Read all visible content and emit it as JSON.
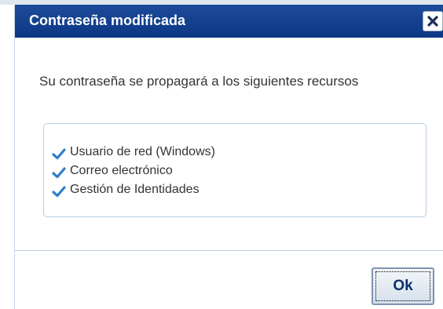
{
  "dialog": {
    "title": "Contraseña modificada",
    "close_icon": "close-icon",
    "message": "Su contraseña se propagará a los siguientes recursos",
    "resources": [
      {
        "label": "Usuario de red (Windows)",
        "icon": "checkmark-icon"
      },
      {
        "label": "Correo electrónico",
        "icon": "checkmark-icon"
      },
      {
        "label": "Gestión de Identidades",
        "icon": "checkmark-icon"
      }
    ],
    "ok_label": "Ok"
  },
  "colors": {
    "titlebar": "#0c3784",
    "checkmark": "#2f7fc9",
    "border": "#b9cde3",
    "text": "#333333"
  }
}
